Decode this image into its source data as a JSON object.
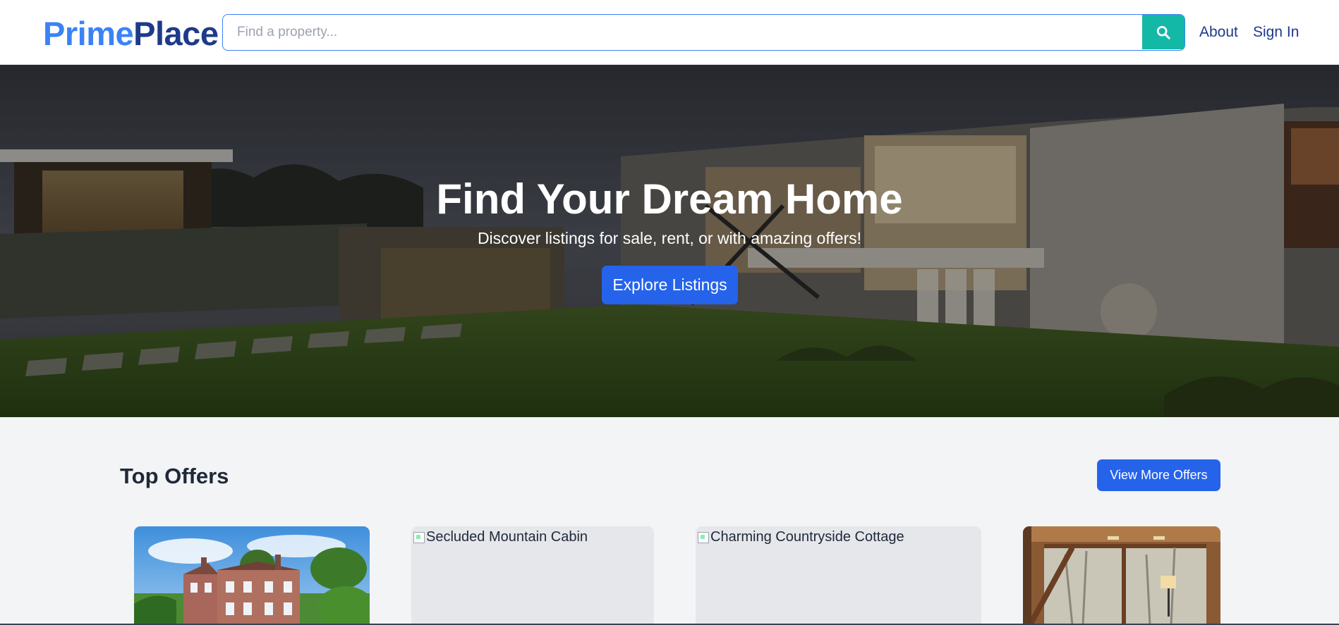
{
  "header": {
    "logo_part1": "Prime",
    "logo_part2": "Place",
    "search_placeholder": "Find a property...",
    "search_icon": "search-icon",
    "nav_about": "About",
    "nav_signin": "Sign In"
  },
  "hero": {
    "title": "Find Your Dream Home",
    "subtitle": "Discover listings for sale, rent, or with amazing offers!",
    "cta_label": "Explore Listings"
  },
  "offers": {
    "title": "Top Offers",
    "view_more_label": "View More Offers",
    "cards": [
      {
        "alt": "",
        "image": "country-manor-photo"
      },
      {
        "alt": "Secluded Mountain Cabin",
        "image": "broken-image-icon"
      },
      {
        "alt": "Charming Countryside Cottage",
        "image": "broken-image-icon"
      },
      {
        "alt": "",
        "image": "wood-interior-photo"
      }
    ]
  },
  "colors": {
    "brand_light": "#3b82f6",
    "brand_dark": "#1e3a8a",
    "accent_teal": "#14b8a6",
    "primary_button": "#2563eb",
    "page_background": "#f3f4f6"
  }
}
